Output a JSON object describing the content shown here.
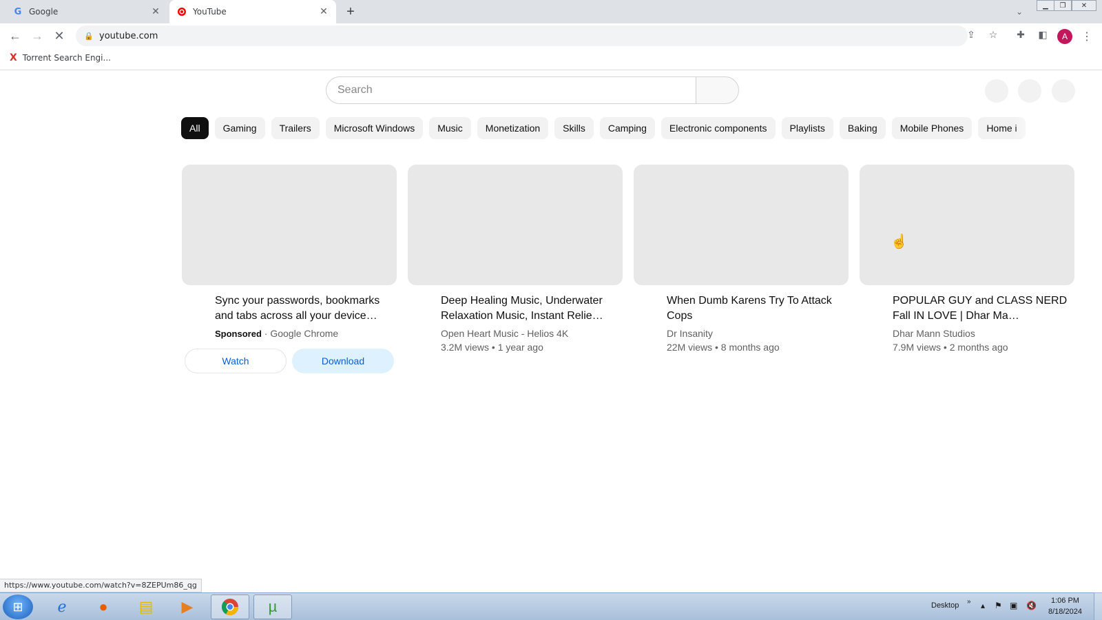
{
  "browser": {
    "tabs": [
      {
        "favicon": "G",
        "title": "Google",
        "active": false
      },
      {
        "favicon": "yt",
        "title": "YouTube",
        "active": true
      }
    ],
    "url": "youtube.com",
    "profile_initial": "A",
    "bookmarks": [
      {
        "label": "Torrent Search Engi..."
      }
    ],
    "status_url": "https://www.youtube.com/watch?v=8ZEPUm86_qg"
  },
  "youtube": {
    "search_placeholder": "Search",
    "chips": [
      "All",
      "Gaming",
      "Trailers",
      "Microsoft Windows",
      "Music",
      "Monetization",
      "Skills",
      "Camping",
      "Electronic components",
      "Playlists",
      "Baking",
      "Mobile Phones",
      "Home i"
    ],
    "ad": {
      "title": "Sync your passwords, bookmarks and tabs across all your device…",
      "sponsored_label": "Sponsored",
      "advertiser": "· Google Chrome",
      "watch_label": "Watch",
      "download_label": "Download"
    },
    "videos": [
      {
        "title": "Deep Healing Music, Underwater Relaxation Music, Instant Relie…",
        "channel": "Open Heart Music - Helios 4K",
        "views": "3.2M views • 1 year ago"
      },
      {
        "title": "When Dumb Karens Try To Attack Cops",
        "channel": "Dr Insanity",
        "views": "22M views • 8 months ago"
      },
      {
        "title": "POPULAR GUY and CLASS NERD Fall IN LOVE | Dhar Ma…",
        "channel": "Dhar Mann Studios",
        "views": "7.9M views • 2 months ago"
      }
    ]
  },
  "taskbar": {
    "desktop_label": "Desktop",
    "time": "1:06 PM",
    "date": "8/18/2024"
  },
  "colors": {
    "chip_selected_bg": "#0f0f0f",
    "thumb_placeholder": "#e8e8e8",
    "link_blue": "#065fd4"
  }
}
